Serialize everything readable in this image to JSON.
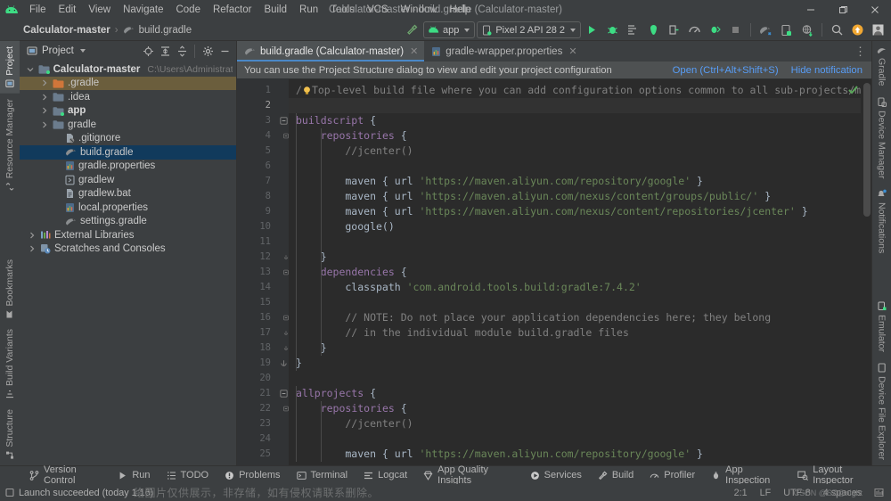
{
  "window": {
    "title": "Calculator-master - build.gradle (Calculator-master)",
    "minimize": "−",
    "maximize": "▢",
    "close": "✕"
  },
  "menu": {
    "items": [
      "File",
      "Edit",
      "View",
      "Navigate",
      "Code",
      "Refactor",
      "Build",
      "Run",
      "Tools",
      "VCS",
      "Window",
      "Help"
    ]
  },
  "breadcrumb": {
    "project": "Calculator-master",
    "separator": "›",
    "file": "build.gradle"
  },
  "toolbar": {
    "build_hammer": "build-icon",
    "run_config": "app",
    "device": "Pixel 2 API 28 2",
    "run": "run-icon",
    "debug": "debug-icon",
    "run_with_coverage": "coverage-icon",
    "profiler": "profiler-icon",
    "stop": "stop-icon",
    "gradle_sync": "gradle-sync-icon",
    "avd_manager": "avd-manager-icon",
    "sdk_manager": "sdk-manager-icon",
    "search": "search-icon",
    "updates": "update-icon",
    "account": "avatar-icon"
  },
  "left_stripe": {
    "items": [
      {
        "label": "Project",
        "selected": true
      },
      {
        "label": "Resource Manager",
        "selected": false
      },
      {
        "label": "Bookmarks",
        "selected": false
      },
      {
        "label": "Build Variants",
        "selected": false
      },
      {
        "label": "Structure",
        "selected": false
      }
    ]
  },
  "right_stripe": {
    "items": [
      {
        "label": "Gradle"
      },
      {
        "label": "Device Manager"
      },
      {
        "label": "Notifications"
      },
      {
        "label": "Emulator"
      },
      {
        "label": "Device File Explorer"
      }
    ]
  },
  "project_panel": {
    "title": "Project",
    "icons": [
      "locate-icon",
      "expand-all-icon",
      "collapse-all-icon",
      "settings-gear-icon",
      "hide-icon"
    ],
    "tree": [
      {
        "label": "Calculator-master",
        "path": "C:\\Users\\Administrator\\De",
        "indent": 0,
        "arrow": "expanded",
        "icon": "module-folder-icon",
        "bold": true,
        "state": "none"
      },
      {
        "label": ".gradle",
        "path": "",
        "indent": 1,
        "arrow": "collapsed",
        "icon": "folder-orange-icon",
        "bold": false,
        "state": "hover"
      },
      {
        "label": ".idea",
        "path": "",
        "indent": 1,
        "arrow": "collapsed",
        "icon": "folder-icon",
        "bold": false,
        "state": "none"
      },
      {
        "label": "app",
        "path": "",
        "indent": 1,
        "arrow": "collapsed",
        "icon": "module-folder-icon",
        "bold": true,
        "state": "none"
      },
      {
        "label": "gradle",
        "path": "",
        "indent": 1,
        "arrow": "collapsed",
        "icon": "folder-icon",
        "bold": false,
        "state": "none"
      },
      {
        "label": ".gitignore",
        "path": "",
        "indent": 2,
        "arrow": "none",
        "icon": "gitignore-file-icon",
        "bold": false,
        "state": "none"
      },
      {
        "label": "build.gradle",
        "path": "",
        "indent": 2,
        "arrow": "none",
        "icon": "gradle-file-icon",
        "bold": false,
        "state": "selected"
      },
      {
        "label": "gradle.properties",
        "path": "",
        "indent": 2,
        "arrow": "none",
        "icon": "properties-file-icon",
        "bold": false,
        "state": "none"
      },
      {
        "label": "gradlew",
        "path": "",
        "indent": 2,
        "arrow": "none",
        "icon": "script-file-icon",
        "bold": false,
        "state": "none"
      },
      {
        "label": "gradlew.bat",
        "path": "",
        "indent": 2,
        "arrow": "none",
        "icon": "bat-file-icon",
        "bold": false,
        "state": "none"
      },
      {
        "label": "local.properties",
        "path": "",
        "indent": 2,
        "arrow": "none",
        "icon": "properties-file-icon",
        "bold": false,
        "state": "none"
      },
      {
        "label": "settings.gradle",
        "path": "",
        "indent": 2,
        "arrow": "none",
        "icon": "gradle-file-icon",
        "bold": false,
        "state": "none"
      },
      {
        "label": "External Libraries",
        "path": "",
        "indent": 0,
        "arrow": "collapsed",
        "icon": "libraries-icon",
        "bold": false,
        "state": "none"
      },
      {
        "label": "Scratches and Consoles",
        "path": "",
        "indent": 0,
        "arrow": "collapsed",
        "icon": "scratches-icon",
        "bold": false,
        "state": "none"
      }
    ]
  },
  "editor_tabs": {
    "tabs": [
      {
        "label": "build.gradle (Calculator-master)",
        "icon": "gradle-file-icon",
        "active": true,
        "close": "✕"
      },
      {
        "label": "gradle-wrapper.properties",
        "icon": "properties-file-icon",
        "active": false,
        "close": "✕"
      }
    ],
    "more": "⋮"
  },
  "notification": {
    "text": "You can use the Project Structure dialog to view and edit your project configuration",
    "open_link": "Open (Ctrl+Alt+Shift+S)",
    "hide_link": "Hide notification"
  },
  "editor": {
    "inspection_status": "no-problems-check-icon",
    "lines": [
      {
        "n": 1,
        "fold": "none",
        "current": false,
        "tokens": [
          {
            "t": "cmt",
            "v": "/"
          },
          {
            "t": "bulb",
            "v": ""
          },
          {
            "t": "cmt",
            "v": "Top-level build file where you can add configuration options common to all sub-projects/modules."
          }
        ]
      },
      {
        "n": 2,
        "fold": "none",
        "current": true,
        "tokens": []
      },
      {
        "n": 3,
        "fold": "open",
        "current": false,
        "tokens": [
          {
            "t": "fn",
            "v": "buildscript"
          },
          {
            "t": "plain",
            "v": " {"
          }
        ]
      },
      {
        "n": 4,
        "fold": "open-inner",
        "current": false,
        "tokens": [
          {
            "t": "plain",
            "v": "    "
          },
          {
            "t": "fn",
            "v": "repositories"
          },
          {
            "t": "plain",
            "v": " {"
          }
        ]
      },
      {
        "n": 5,
        "fold": "none",
        "current": false,
        "tokens": [
          {
            "t": "cmt",
            "v": "        //jcenter()"
          }
        ]
      },
      {
        "n": 6,
        "fold": "none",
        "current": false,
        "tokens": []
      },
      {
        "n": 7,
        "fold": "none",
        "current": false,
        "tokens": [
          {
            "t": "plain",
            "v": "        maven { url "
          },
          {
            "t": "str",
            "v": "'https://maven.aliyun.com/repository/google'"
          },
          {
            "t": "plain",
            "v": " }"
          }
        ]
      },
      {
        "n": 8,
        "fold": "none",
        "current": false,
        "tokens": [
          {
            "t": "plain",
            "v": "        maven { url "
          },
          {
            "t": "str",
            "v": "'https://maven.aliyun.com/nexus/content/groups/public/'"
          },
          {
            "t": "plain",
            "v": " }"
          }
        ]
      },
      {
        "n": 9,
        "fold": "none",
        "current": false,
        "tokens": [
          {
            "t": "plain",
            "v": "        maven { url "
          },
          {
            "t": "str",
            "v": "'https://maven.aliyun.com/nexus/content/repositories/jcenter'"
          },
          {
            "t": "plain",
            "v": " }"
          }
        ]
      },
      {
        "n": 10,
        "fold": "none",
        "current": false,
        "tokens": [
          {
            "t": "plain",
            "v": "        google()"
          }
        ]
      },
      {
        "n": 11,
        "fold": "none",
        "current": false,
        "tokens": []
      },
      {
        "n": 12,
        "fold": "close-inner",
        "current": false,
        "tokens": [
          {
            "t": "plain",
            "v": "    }"
          }
        ]
      },
      {
        "n": 13,
        "fold": "open-inner",
        "current": false,
        "tokens": [
          {
            "t": "plain",
            "v": "    "
          },
          {
            "t": "fn",
            "v": "dependencies"
          },
          {
            "t": "plain",
            "v": " {"
          }
        ]
      },
      {
        "n": 14,
        "fold": "none",
        "current": false,
        "tokens": [
          {
            "t": "plain",
            "v": "        classpath "
          },
          {
            "t": "str",
            "v": "'com.android.tools.build:gradle:7.4.2'"
          }
        ]
      },
      {
        "n": 15,
        "fold": "none",
        "current": false,
        "tokens": []
      },
      {
        "n": 16,
        "fold": "open-inner",
        "current": false,
        "tokens": [
          {
            "t": "cmt",
            "v": "        // NOTE: Do not place your application dependencies here; they belong"
          }
        ]
      },
      {
        "n": 17,
        "fold": "close-inner",
        "current": false,
        "tokens": [
          {
            "t": "cmt",
            "v": "        // in the individual module build.gradle files"
          }
        ]
      },
      {
        "n": 18,
        "fold": "close-inner",
        "current": false,
        "tokens": [
          {
            "t": "plain",
            "v": "    }"
          }
        ]
      },
      {
        "n": 19,
        "fold": "close",
        "current": false,
        "tokens": [
          {
            "t": "plain",
            "v": "}"
          }
        ]
      },
      {
        "n": 20,
        "fold": "none",
        "current": false,
        "tokens": []
      },
      {
        "n": 21,
        "fold": "open",
        "current": false,
        "tokens": [
          {
            "t": "fn",
            "v": "allprojects"
          },
          {
            "t": "plain",
            "v": " {"
          }
        ]
      },
      {
        "n": 22,
        "fold": "open-inner",
        "current": false,
        "tokens": [
          {
            "t": "plain",
            "v": "    "
          },
          {
            "t": "fn",
            "v": "repositories"
          },
          {
            "t": "plain",
            "v": " {"
          }
        ]
      },
      {
        "n": 23,
        "fold": "none",
        "current": false,
        "tokens": [
          {
            "t": "cmt",
            "v": "        //jcenter()"
          }
        ]
      },
      {
        "n": 24,
        "fold": "none",
        "current": false,
        "tokens": []
      },
      {
        "n": 25,
        "fold": "none",
        "current": false,
        "tokens": [
          {
            "t": "plain",
            "v": "        maven { url "
          },
          {
            "t": "str",
            "v": "'https://maven.aliyun.com/repository/google'"
          },
          {
            "t": "plain",
            "v": " }"
          }
        ]
      }
    ]
  },
  "bottom_bar": {
    "tabs": [
      {
        "label": "Version Control",
        "icon": "branch-icon"
      },
      {
        "label": "Run",
        "icon": "run-icon"
      },
      {
        "label": "TODO",
        "icon": "todo-icon"
      },
      {
        "label": "Problems",
        "icon": "problems-icon"
      },
      {
        "label": "Terminal",
        "icon": "terminal-icon"
      },
      {
        "label": "Logcat",
        "icon": "logcat-icon"
      },
      {
        "label": "App Quality Insights",
        "icon": "insights-icon"
      },
      {
        "label": "Services",
        "icon": "services-icon"
      },
      {
        "label": "Build",
        "icon": "build-hammer-icon"
      },
      {
        "label": "Profiler",
        "icon": "profiler-icon"
      },
      {
        "label": "App Inspection",
        "icon": "app-inspection-icon"
      }
    ],
    "right_tab": {
      "label": "Layout Inspector",
      "icon": "layout-inspector-icon"
    }
  },
  "status_bar": {
    "message": "Launch succeeded (today 1:16)",
    "caret_position": "2:1",
    "line_separator": "LF",
    "encoding": "UTF-8",
    "indent": "4 spaces",
    "watermark": "络图片仅供展示，非存储，如有侵权请联系删除。",
    "watermark_small": "CSDN @SZ@night"
  }
}
